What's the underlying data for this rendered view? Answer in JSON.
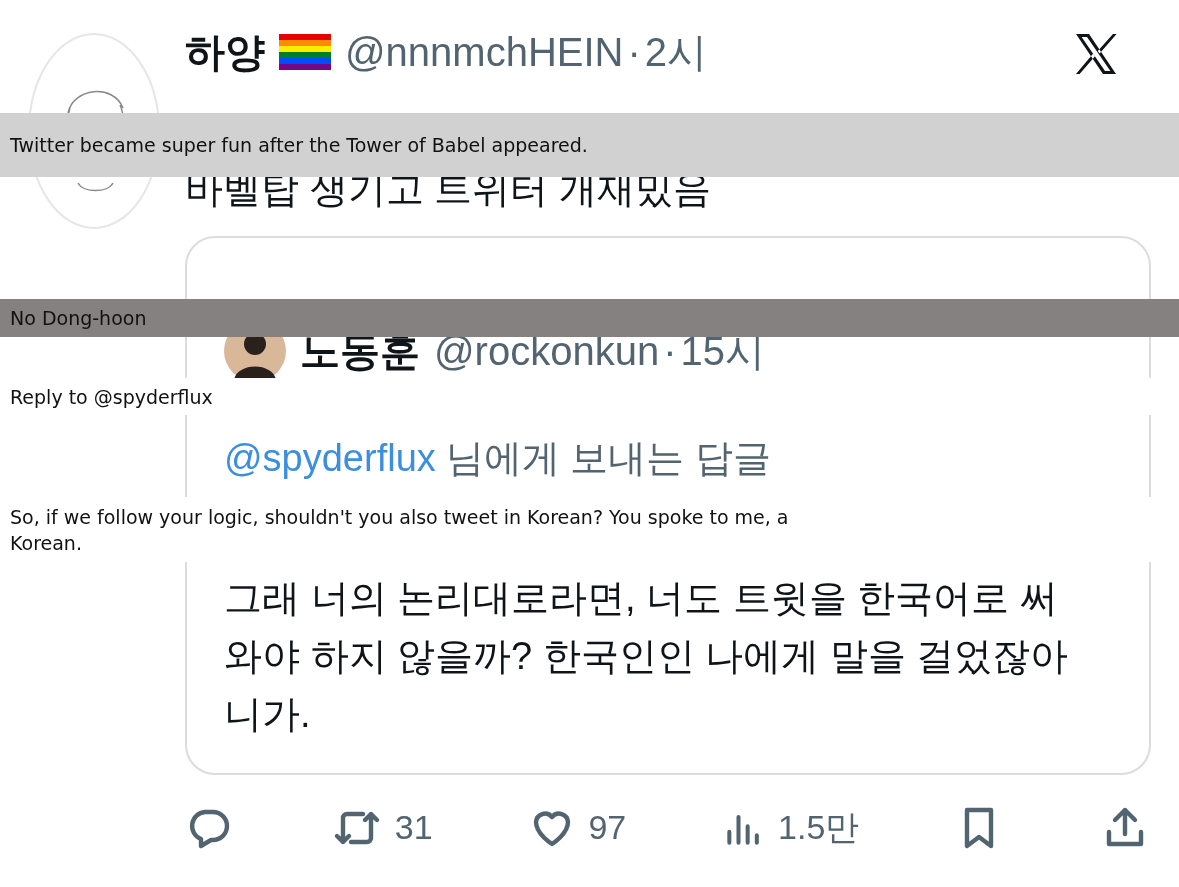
{
  "tweet": {
    "author": {
      "name": "하양",
      "handle": "@nnnmchHEIN",
      "separator": "·",
      "time": "2시"
    },
    "text": "바벨탑 생기고 트위터 개재밌음",
    "quote": {
      "author": {
        "name": "노동훈",
        "handle": "@rockonkun",
        "separator": "·",
        "time": "15시"
      },
      "reply_to": {
        "handle": "@spyderflux",
        "suffix": "님에게 보내는 답글"
      },
      "text": "그래 너의 논리대로라면, 너도 트윗을 한국어로 써와야 하지 않을까? 한국인인 나에게 말을 걸었잖아니가."
    },
    "actions": [
      {
        "kind": "reply"
      },
      {
        "kind": "retweet",
        "count": "31"
      },
      {
        "kind": "like",
        "count": "97"
      },
      {
        "kind": "views",
        "count": "1.5만"
      },
      {
        "kind": "bookmark"
      },
      {
        "kind": "share"
      }
    ]
  },
  "translations": [
    {
      "kind": "band",
      "text": "Twitter became super fun after the Tower of Babel appeared."
    },
    {
      "kind": "dark",
      "text": "No Dong-hoon"
    },
    {
      "kind": "plain",
      "text": "Reply to @spyderflux"
    },
    {
      "kind": "plain",
      "text": "So, if we follow your logic, shouldn't you also tweet in Korean? You spoke to me, a Korean."
    }
  ]
}
